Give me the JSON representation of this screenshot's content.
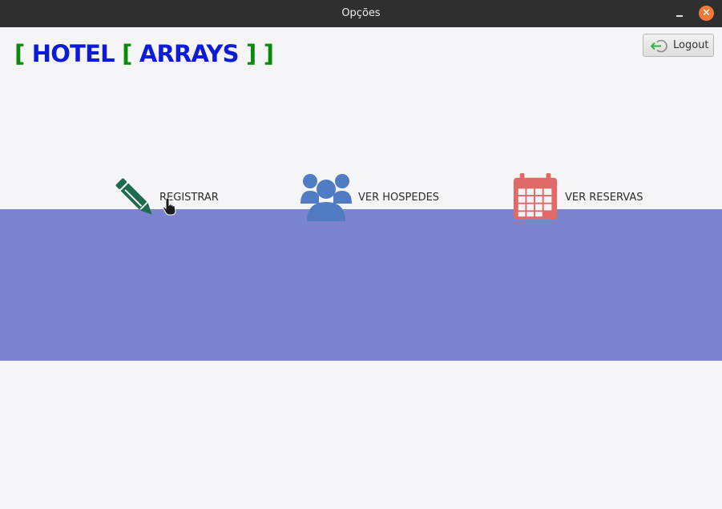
{
  "window": {
    "title": "Opções"
  },
  "logo": {
    "open1": "[",
    "word1": "HOTEL",
    "open2": "[",
    "word2": "ARRAYS",
    "close": "] ]"
  },
  "header": {
    "logout_label": "Logout"
  },
  "options": [
    {
      "label": "REGISTRAR",
      "icon": "pencil-icon",
      "color": "#1e6b4d"
    },
    {
      "label": "VER HOSPEDES",
      "icon": "users-icon",
      "color": "#4f7cc2"
    },
    {
      "label": "VER RESERVAS",
      "icon": "calendar-icon",
      "color": "#e06a6a"
    }
  ],
  "colors": {
    "band": "#7b84cc",
    "logo_bracket": "#0a8a0a",
    "logo_word": "#0b1bd6",
    "titlebar": "#2f2f2f",
    "close": "#f07a3a"
  }
}
